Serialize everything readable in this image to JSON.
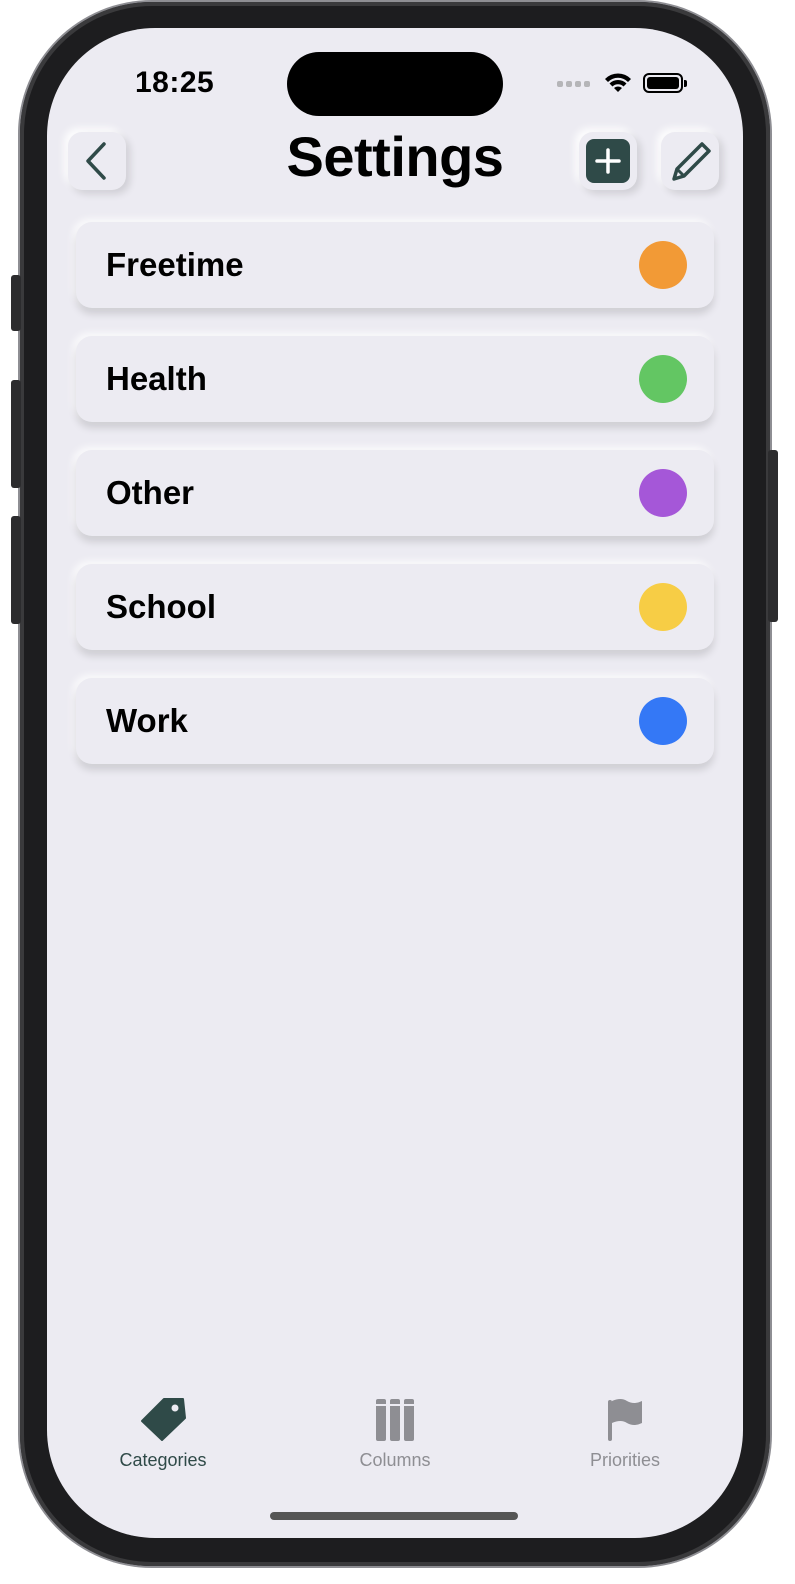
{
  "status_bar": {
    "time": "18:25",
    "icons": [
      "cellular-icon",
      "wifi-icon",
      "battery-icon"
    ]
  },
  "header": {
    "title": "Settings",
    "back_icon": "chevron-left-icon",
    "add_icon": "plus-icon",
    "edit_icon": "pencil-icon"
  },
  "categories": [
    {
      "label": "Freetime",
      "color": "#F29A36"
    },
    {
      "label": "Health",
      "color": "#63C663"
    },
    {
      "label": "Other",
      "color": "#A557D8"
    },
    {
      "label": "School",
      "color": "#F7CD45"
    },
    {
      "label": "Work",
      "color": "#3478F6"
    }
  ],
  "tab_bar": {
    "tabs": [
      {
        "label": "Categories",
        "icon": "tag-icon",
        "active": true
      },
      {
        "label": "Columns",
        "icon": "columns-icon",
        "active": false
      },
      {
        "label": "Priorities",
        "icon": "flag-icon",
        "active": false
      }
    ]
  },
  "colors": {
    "accent": "#2F4A48",
    "inactive": "#8E8E93",
    "background": "#ECEBF2"
  }
}
